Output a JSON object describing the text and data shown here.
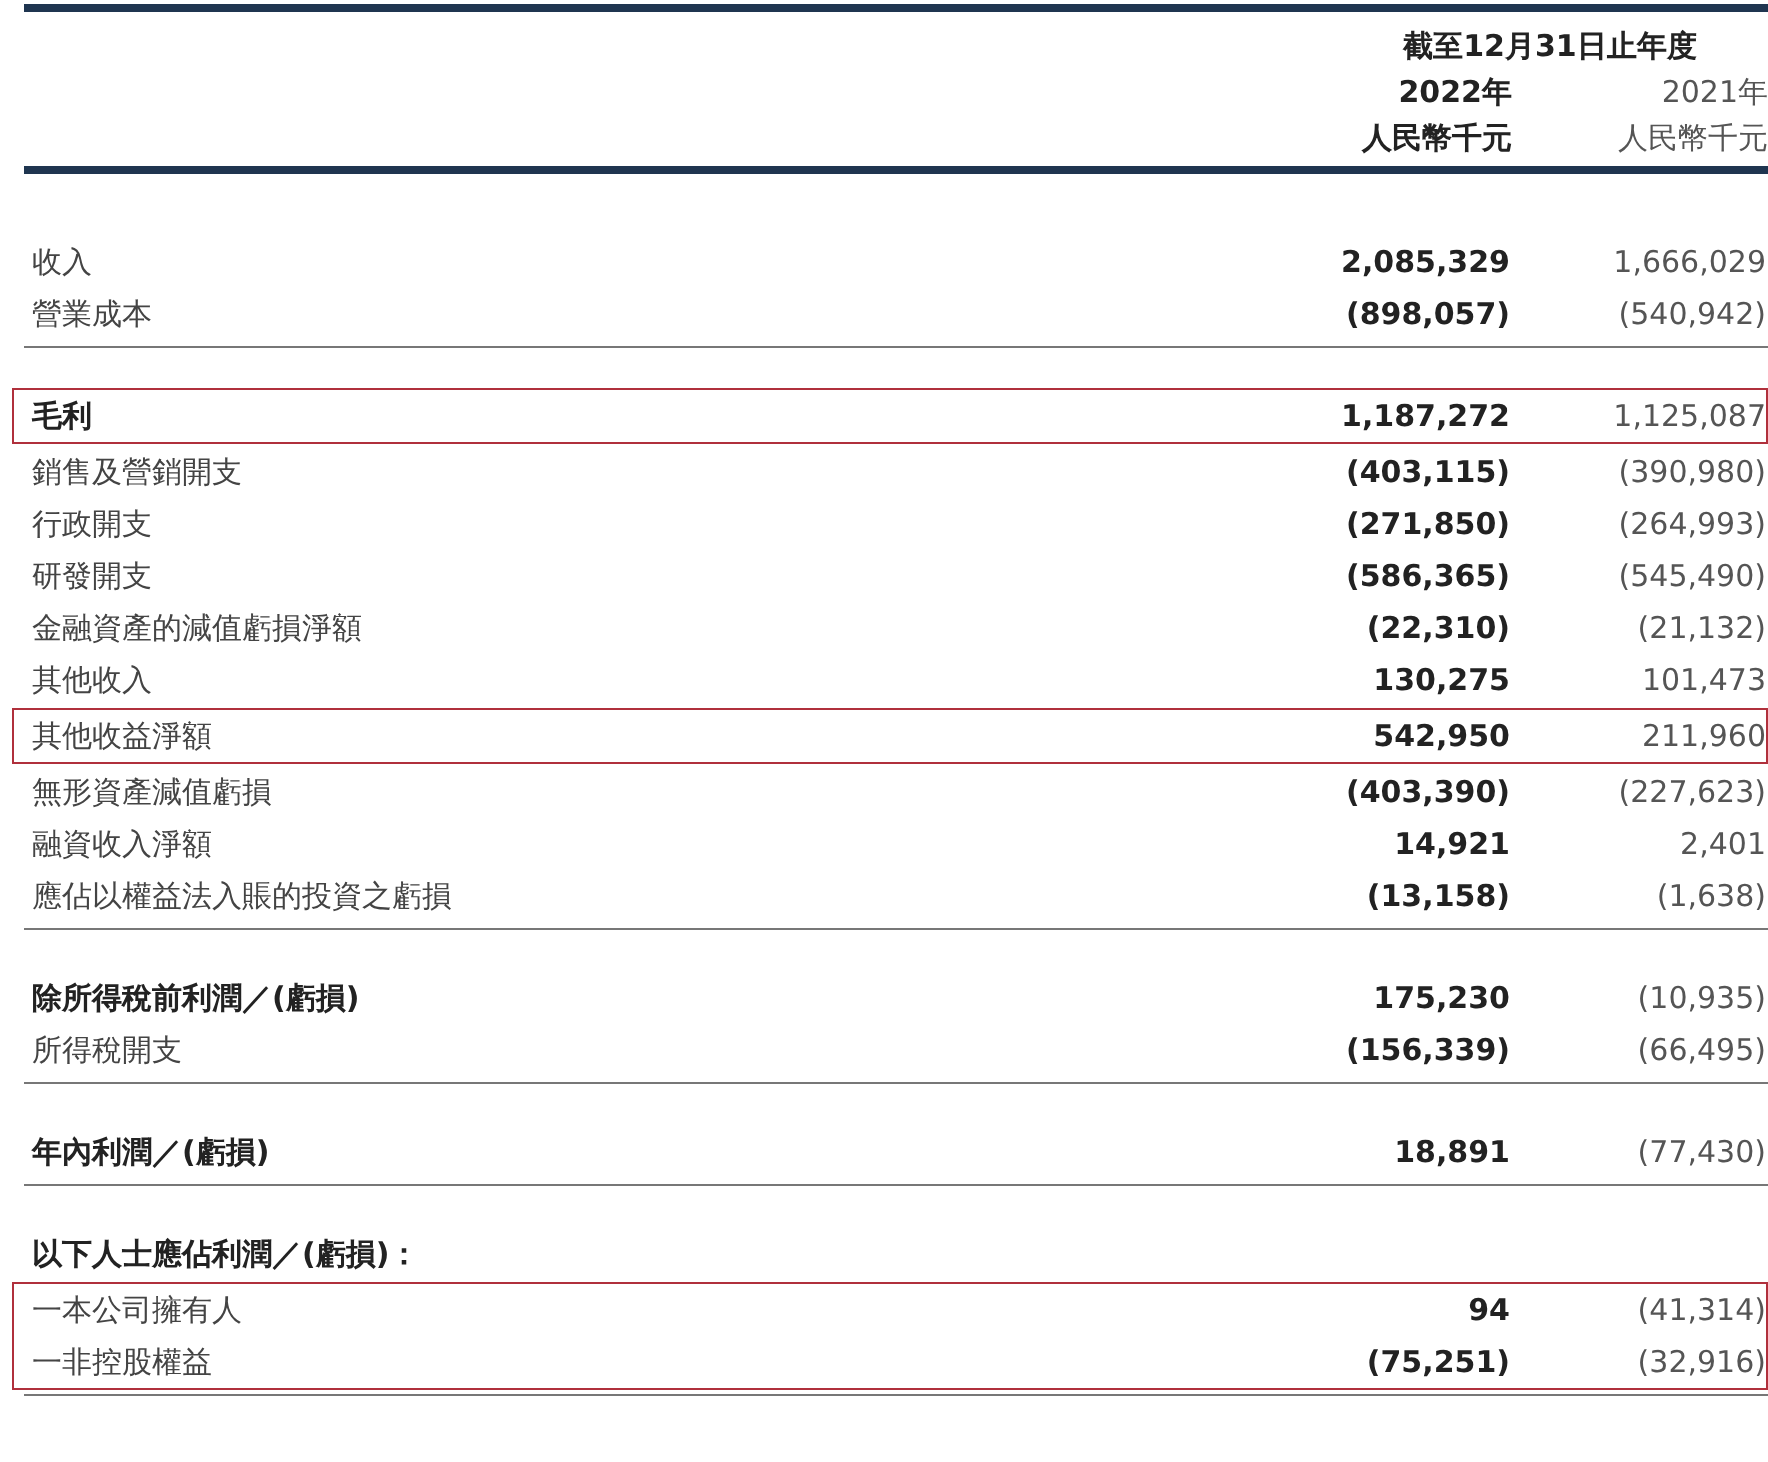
{
  "header": {
    "period": "截至12月31日止年度",
    "years": [
      "2022年",
      "2021年"
    ],
    "units": [
      "人民幣千元",
      "人民幣千元"
    ]
  },
  "sections": [
    {
      "groups": [
        {
          "boxed": false,
          "rows": [
            {
              "label": "收入",
              "bold": false,
              "values": [
                "2,085,329",
                "1,666,029"
              ]
            },
            {
              "label": "營業成本",
              "bold": false,
              "values": [
                "(898,057)",
                "(540,942)"
              ]
            }
          ]
        }
      ]
    },
    {
      "groups": [
        {
          "boxed": true,
          "rows": [
            {
              "label": "毛利",
              "bold": true,
              "values": [
                "1,187,272",
                "1,125,087"
              ]
            }
          ]
        },
        {
          "boxed": false,
          "rows": [
            {
              "label": "銷售及營銷開支",
              "bold": false,
              "values": [
                "(403,115)",
                "(390,980)"
              ]
            },
            {
              "label": "行政開支",
              "bold": false,
              "values": [
                "(271,850)",
                "(264,993)"
              ]
            },
            {
              "label": "研發開支",
              "bold": false,
              "values": [
                "(586,365)",
                "(545,490)"
              ]
            },
            {
              "label": "金融資產的減值虧損淨額",
              "bold": false,
              "values": [
                "(22,310)",
                "(21,132)"
              ]
            },
            {
              "label": "其他收入",
              "bold": false,
              "values": [
                "130,275",
                "101,473"
              ]
            }
          ]
        },
        {
          "boxed": true,
          "rows": [
            {
              "label": "其他收益淨額",
              "bold": false,
              "values": [
                "542,950",
                "211,960"
              ]
            }
          ]
        },
        {
          "boxed": false,
          "rows": [
            {
              "label": "無形資產減值虧損",
              "bold": false,
              "values": [
                "(403,390)",
                "(227,623)"
              ]
            },
            {
              "label": "融資收入淨額",
              "bold": false,
              "values": [
                "14,921",
                "2,401"
              ]
            },
            {
              "label": "應佔以權益法入賬的投資之虧損",
              "bold": false,
              "values": [
                "(13,158)",
                "(1,638)"
              ]
            }
          ]
        }
      ]
    },
    {
      "groups": [
        {
          "boxed": false,
          "rows": [
            {
              "label": "除所得稅前利潤／(虧損)",
              "bold": true,
              "values": [
                "175,230",
                "(10,935)"
              ]
            },
            {
              "label": "所得稅開支",
              "bold": false,
              "values": [
                "(156,339)",
                "(66,495)"
              ]
            }
          ]
        }
      ]
    },
    {
      "groups": [
        {
          "boxed": false,
          "rows": [
            {
              "label": "年內利潤／(虧損)",
              "bold": true,
              "values": [
                "18,891",
                "(77,430)"
              ]
            }
          ]
        }
      ]
    },
    {
      "groups": [
        {
          "boxed": false,
          "rows": [
            {
              "label": "以下人士應佔利潤／(虧損)：",
              "bold": true
            }
          ]
        },
        {
          "boxed": true,
          "rows": [
            {
              "label": "一本公司擁有人",
              "bold": false,
              "values": [
                "94",
                "(41,314)"
              ]
            },
            {
              "label": "一非控股權益",
              "bold": false,
              "values": [
                "(75,251)",
                "(32,916)"
              ]
            }
          ]
        }
      ]
    }
  ]
}
